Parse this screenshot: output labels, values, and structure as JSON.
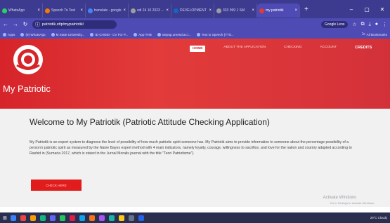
{
  "browser": {
    "tabs": [
      {
        "label": "WhatsApp",
        "color": "#25d366"
      },
      {
        "label": "Speech To Text",
        "color": "#f57c00"
      },
      {
        "label": "translate - google",
        "color": "#4285f4"
      },
      {
        "label": "sdi 24 10 2023 ...",
        "color": "#9e9e9e"
      },
      {
        "label": "DEVELOPMENT A",
        "color": "#1565c0"
      },
      {
        "label": "333 999 1 SM",
        "color": "#9e9e9e"
      },
      {
        "label": "my patriotik",
        "color": "#e53935"
      }
    ],
    "new_tab": "+",
    "window_controls": {
      "minimize": "–",
      "maximize": "▢",
      "close": "✕"
    },
    "url": "patriotik.sttp/mypatriotik/",
    "google_lens": "Google Lens",
    "bookmarks": [
      "Apps",
      "(9) WhatsApp",
      "M State University...",
      "ID CHOID - CV For P...",
      "App THB",
      "stepup.umesd.ac.i...",
      "Text to Speech (TTS..."
    ],
    "bookmarks_right": "All Bookmarks"
  },
  "site": {
    "title": "My Patriotic",
    "nav": {
      "home": "HOME",
      "about": "ABOUT THE APPLICATION",
      "checking": "CHECKING",
      "account": "ACCOUNT",
      "credits": "CREDITS"
    },
    "hero": {
      "heading": "Welcome to My Patriotik (Patriotic Attitude Checking Application)",
      "paragraph": "My Patriotik is an expert system to diagnose the level of possibility of how much patriotic spirit someone has. My Patriotik aims to provide information to someone about the percentage possibility of a person's patriotic spirit as measured by the Naive Bayes expert method with 4 main indicators, namely loyalty, courage, willingness to sacrifice, and love for the nation and country adapted according to Rashid in (Sumaria 2017, which is stated in the Jurnal Moralis journal with the title \"Teori Patriotisme\").",
      "button": "CHECK HERE"
    },
    "activate": {
      "line1": "Activate Windows",
      "line2": "Go to Settings to activate Windows."
    }
  },
  "taskbar": {
    "weather": "29°C Cloudy",
    "icons": [
      "#3b82f6",
      "#ef4444",
      "#f59e0b",
      "#10b981",
      "#6366f1",
      "#22c55e",
      "#e11d48",
      "#0ea5e9",
      "#f97316",
      "#a855f7",
      "#14b8a6",
      "#facc15",
      "#64748b",
      "#2563eb"
    ]
  },
  "colors": {
    "header_red": "#d6242a",
    "button_red": "#e11c1c",
    "chrome_purple": "#4e4cb4"
  }
}
